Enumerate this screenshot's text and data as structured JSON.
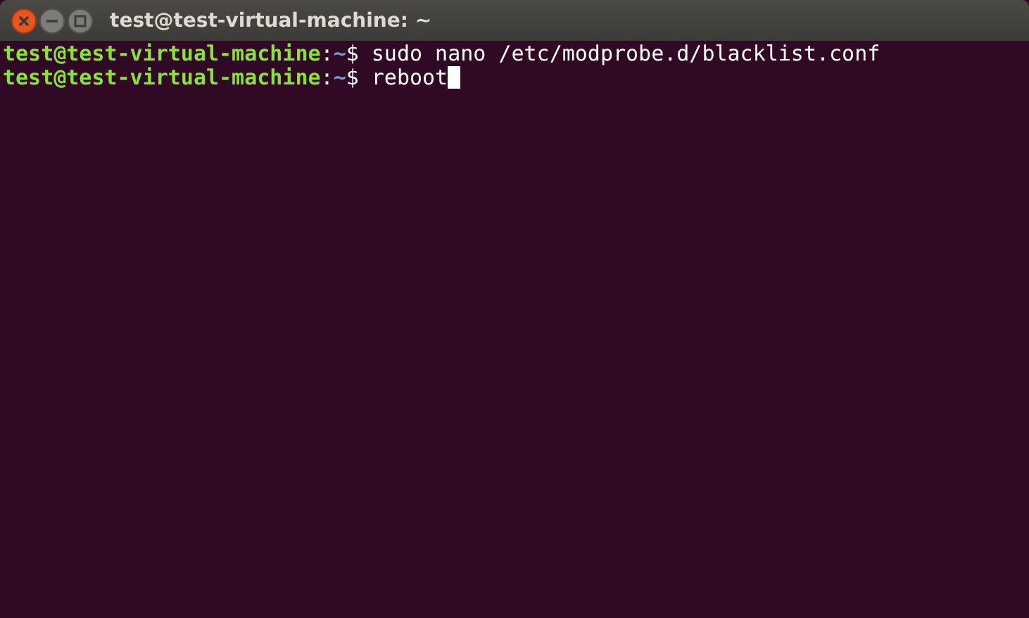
{
  "window": {
    "title": "test@test-virtual-machine: ~"
  },
  "terminal": {
    "lines": [
      {
        "user_host": "test@test-virtual-machine",
        "separator": ":",
        "path": "~",
        "symbol": "$",
        "command": "sudo nano /etc/modprobe.d/blacklist.conf",
        "cursor": false
      },
      {
        "user_host": "test@test-virtual-machine",
        "separator": ":",
        "path": "~",
        "symbol": "$",
        "command": "reboot",
        "cursor": true
      }
    ]
  }
}
